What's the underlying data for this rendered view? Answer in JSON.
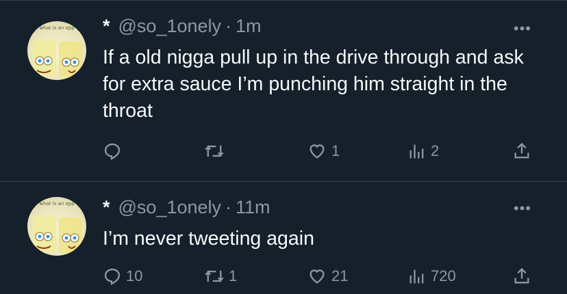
{
  "tweets": [
    {
      "avatar_caption": "what is an opp",
      "display_name": "*",
      "handle": "@so_1onely",
      "separator": "·",
      "time": "1m",
      "more_label": "•••",
      "text": "If a old nigga pull up in the drive through and ask for extra sauce I’m punching him straight in the throat",
      "reply_count": "",
      "retweet_count": "",
      "like_count": "1",
      "view_count": "2"
    },
    {
      "avatar_caption": "what is an opp",
      "display_name": "*",
      "handle": "@so_1onely",
      "separator": "·",
      "time": "11m",
      "more_label": "•••",
      "text": "I’m never tweeting again",
      "reply_count": "10",
      "retweet_count": "1",
      "like_count": "21",
      "view_count": "720"
    }
  ],
  "icons": {
    "reply": "reply-icon",
    "retweet": "retweet-icon",
    "like": "heart-icon",
    "views": "views-icon",
    "share": "share-icon"
  },
  "colors": {
    "background": "#15202b",
    "text": "#f7f9f9",
    "secondary": "#8b98a5",
    "divider": "#38444d"
  }
}
